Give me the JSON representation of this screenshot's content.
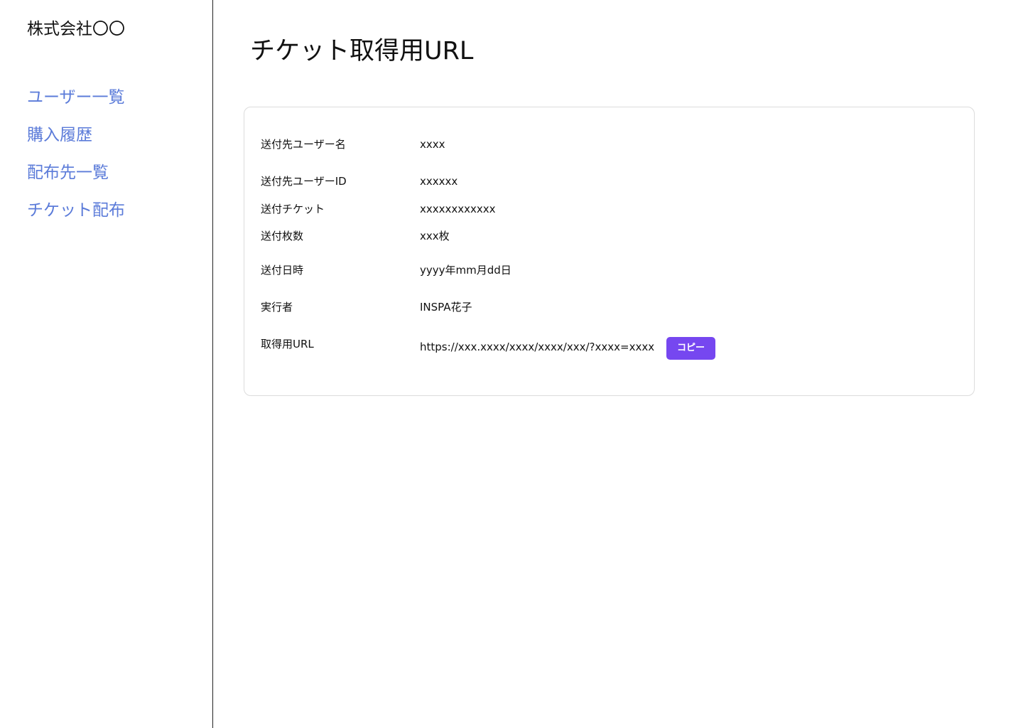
{
  "sidebar": {
    "company_name": "株式会社〇〇",
    "nav": {
      "users": "ユーザー一覧",
      "purchase_history": "購入履歴",
      "recipients": "配布先一覧",
      "ticket_distribution": "チケット配布"
    }
  },
  "main": {
    "title": "チケット取得用URL",
    "details": {
      "recipient_user_name": {
        "label": "送付先ユーザー名",
        "value": "xxxx"
      },
      "recipient_user_id": {
        "label": "送付先ユーザーID",
        "value": "xxxxxx"
      },
      "ticket": {
        "label": "送付チケット",
        "value": "xxxxxxxxxxxx"
      },
      "quantity": {
        "label": "送付枚数",
        "value": "xxx枚"
      },
      "sent_date": {
        "label": "送付日時",
        "value": "yyyy年mm月dd日"
      },
      "executor": {
        "label": "実行者",
        "value": "INSPA花子"
      },
      "url": {
        "label": "取得用URL",
        "value": "https://xxx.xxxx/xxxx/xxxx/xxx/?xxxx=xxxx"
      }
    },
    "copy_label": "コピー"
  },
  "colors": {
    "nav_link": "#5b7bd9",
    "copy_button_bg": "#7647f0",
    "card_border": "#dcdcdc"
  }
}
